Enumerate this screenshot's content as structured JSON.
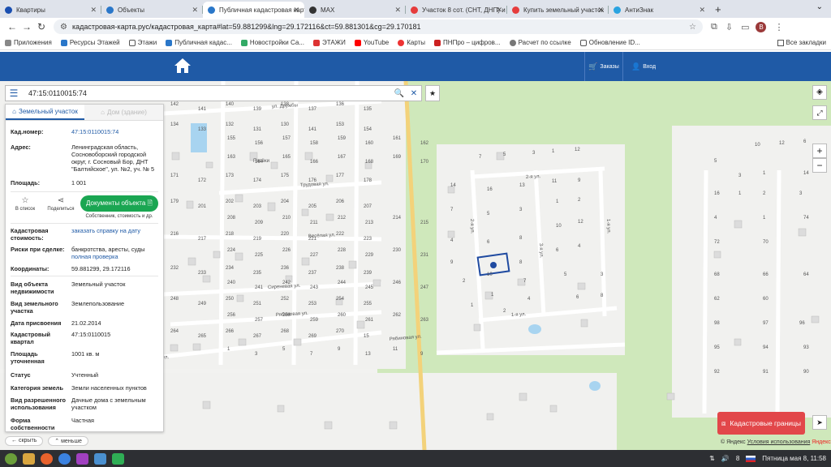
{
  "browser": {
    "tabs": [
      {
        "title": "Квартиры",
        "color": "#1a4fb0"
      },
      {
        "title": "Объекты",
        "color": "#2a77c9"
      },
      {
        "title": "Публичная кадастровая карта",
        "color": "#2a77c9",
        "active": true
      },
      {
        "title": "MAX",
        "color": "#333"
      },
      {
        "title": "Участок 8 сот. (СНТ, ДНП) и",
        "color": "#e63c3c"
      },
      {
        "title": "Купить земельный участок",
        "color": "#e63c3c"
      },
      {
        "title": "АнтиЗнак",
        "color": "#2aa3e0"
      }
    ],
    "watermark": "Недвижимость",
    "url": "кадастровая-карта.рус/кадастровая_карта#lat=59.881299&lng=29.172116&ct=59.881301&cg=29.170181",
    "avatar": "В",
    "bookmarks": [
      "Приложения",
      "Ресурсы Этажей",
      "Этажи",
      "Публичная кадас...",
      "Новостройки Са...",
      "ЭТАЖИ",
      "YouTube",
      "Карты",
      "ПНПро – цифров...",
      "Расчет по ссылке",
      "Обновление ID..."
    ],
    "all_bookmarks": "Все закладки"
  },
  "header": {
    "orders": "Заказы",
    "login": "Вход"
  },
  "search": {
    "value": "47:15:0110015:74"
  },
  "panel": {
    "tab_land": "Земельный участок",
    "tab_house": "Дом (здание)",
    "cad_number_label": "Кад.номер:",
    "cad_number": "47:15:0110015:74",
    "address_label": "Адрес:",
    "address": "Ленинградская область, Сосновоборский городской округ, г. Сосновый Бор, ДНТ \"Балтийское\", ул. №2, уч. № 5",
    "area_label": "Площадь:",
    "area": "1 001",
    "action_list": "В список",
    "action_share": "Поделиться",
    "docs_button": "Документы объекта",
    "docs_sub": "Собственник, стоимость и др.",
    "cad_value_label": "Кадастровая стоимость:",
    "cad_value": "заказать справку на дату",
    "risks_label": "Риски при сделке:",
    "risks": "банкротства, аресты, суды",
    "risks_link": "полная проверка",
    "coords_label": "Координаты:",
    "coords": "59.881299, 29.172116",
    "obj_type_label": "Вид объекта недвижимости",
    "obj_type": "Земельный участок",
    "land_type_label": "Вид земельного участка",
    "land_type": "Землепользование",
    "date_label": "Дата присвоения",
    "date": "21.02.2014",
    "quarter_label": "Кадастровый квартал",
    "quarter": "47:15:0110015",
    "spec_area_label": "Площадь уточненная",
    "spec_area": "1001 кв. м",
    "status_label": "Статус",
    "status": "Учтенный",
    "category_label": "Категория земель",
    "category": "Земли населенных пунктов",
    "permitted_label": "Вид разрешенного использования",
    "permitted": "Дачные дома с земельным участком",
    "ownership_label": "Форма собственности",
    "ownership": "Частная"
  },
  "map": {
    "streets": [
      "ул. Дружбы",
      "Трудовая ул.",
      "Весёлая ул.",
      "Сиреневая ул.",
      "Рябиновая ул.",
      "Рябиновая ул.",
      "1-я ул.",
      "2-я ул.",
      "3-я ул.",
      "1-я ул.",
      "2-я ул.",
      "1-я ул.",
      "Пасёки"
    ],
    "plot_numbers": [
      "142",
      "141",
      "140",
      "139",
      "138",
      "137",
      "136",
      "135",
      "134",
      "133",
      "132",
      "131",
      "130",
      "141",
      "153",
      "154",
      "155",
      "156",
      "157",
      "158",
      "159",
      "160",
      "161",
      "162",
      "163",
      "164",
      "165",
      "166",
      "167",
      "168",
      "169",
      "170",
      "171",
      "172",
      "173",
      "174",
      "175",
      "176",
      "177",
      "178",
      "179",
      "201",
      "202",
      "203",
      "204",
      "205",
      "206",
      "207",
      "208",
      "209",
      "210",
      "211",
      "212",
      "213",
      "214",
      "215",
      "216",
      "217",
      "218",
      "219",
      "220",
      "221",
      "222",
      "223",
      "224",
      "225",
      "226",
      "227",
      "228",
      "229",
      "230",
      "231",
      "232",
      "233",
      "234",
      "235",
      "236",
      "237",
      "238",
      "239",
      "240",
      "241",
      "242",
      "243",
      "244",
      "245",
      "246",
      "247",
      "248",
      "249",
      "250",
      "251",
      "252",
      "253",
      "254",
      "255",
      "256",
      "257",
      "258",
      "259",
      "260",
      "261",
      "262",
      "263",
      "264",
      "265",
      "266",
      "267",
      "268",
      "269",
      "270",
      "15",
      "1",
      "3",
      "5",
      "7",
      "9",
      "13",
      "11",
      "9",
      "7",
      "5",
      "3",
      "1",
      "12",
      "14",
      "16",
      "13",
      "11",
      "9",
      "7",
      "5",
      "3",
      "1",
      "2",
      "4",
      "6",
      "8",
      "10",
      "12",
      "9",
      "10",
      "8",
      "6",
      "4",
      "2",
      "1",
      "7",
      "5",
      "3",
      "1",
      "2",
      "4",
      "6",
      "8",
      "10",
      "12",
      "6",
      "5",
      "3",
      "1",
      "14",
      "16",
      "1",
      "2",
      "3",
      "4",
      "1",
      "74",
      "72",
      "70",
      "68",
      "66",
      "64",
      "62",
      "60",
      "98",
      "97",
      "96",
      "95",
      "94",
      "93",
      "92",
      "91",
      "90"
    ],
    "kad_button": "Кадастровые границы",
    "attrib_brand": "© Яндекс",
    "attrib_link": "Условия использования",
    "yandex": "Яндекс",
    "ctrl_hide": "скрыть",
    "ctrl_less": "меньше"
  },
  "taskbar": {
    "lang": "8",
    "datetime": "Пятница мая 8, 11:58"
  },
  "colors": {
    "header": "#1f5aa6",
    "green": "#1aa652",
    "red": "#e2474a",
    "park": "#c9e6b3",
    "road_yellow": "#f3d27a"
  }
}
